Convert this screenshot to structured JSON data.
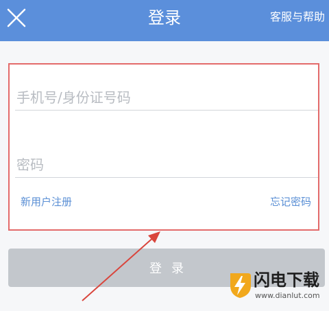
{
  "header": {
    "title": "登录",
    "help_label": "客服与帮助",
    "close_icon": "close-icon",
    "background_color": "#5b8fdb"
  },
  "form": {
    "phone_placeholder": "手机号/身份证号码",
    "password_placeholder": "密码",
    "register_label": "新用户注册",
    "forgot_label": "忘记密码",
    "highlight_color": "#e36a6a",
    "link_color": "#5a8fd5"
  },
  "login_button": {
    "label": "登录",
    "color": "#c3c7cc"
  },
  "annotation": {
    "arrow_color": "#d9453c"
  },
  "watermark": {
    "name": "闪电下载",
    "url": "www.dianlut.com",
    "logo_icon": "lightning-logo-icon"
  }
}
